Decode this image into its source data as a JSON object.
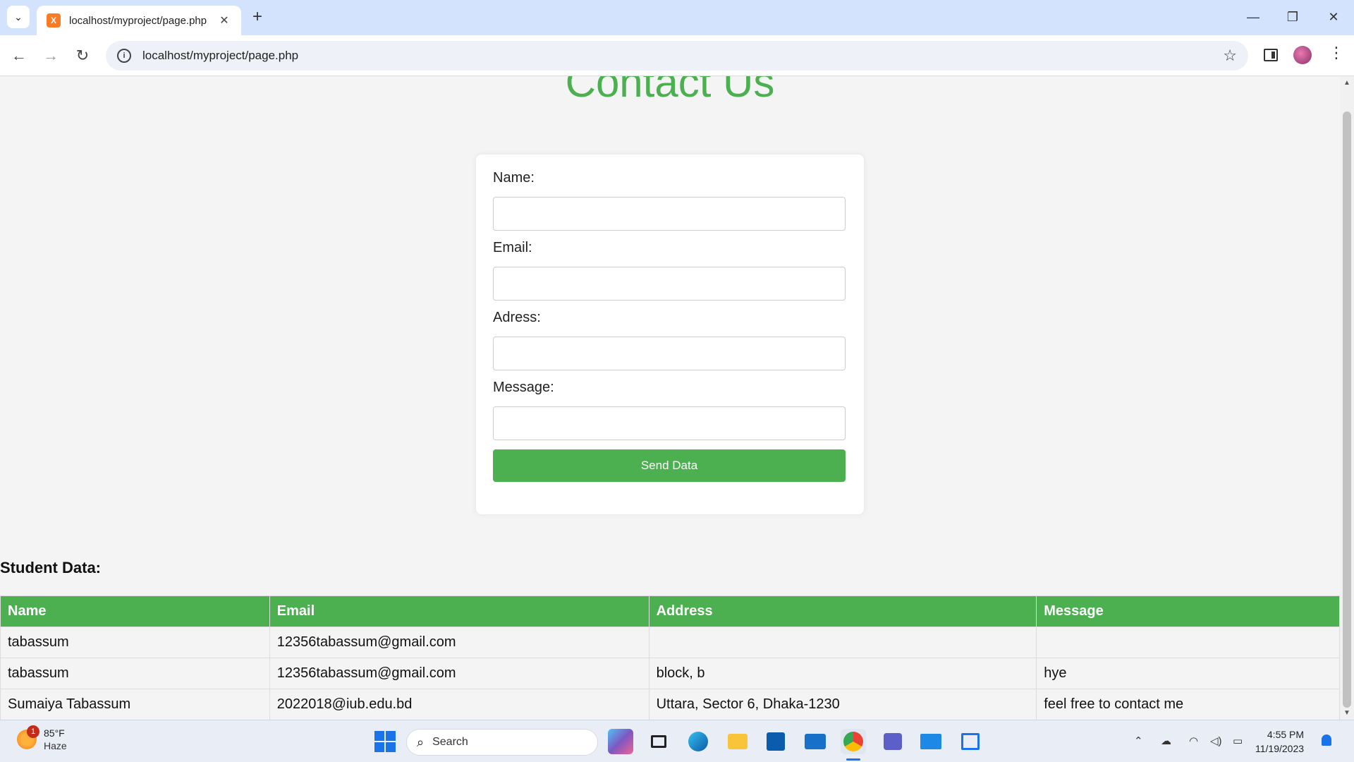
{
  "browser": {
    "tab_title": "localhost/myproject/page.php",
    "url": "localhost/myproject/page.php",
    "favicon_letter": "X"
  },
  "page": {
    "title": "Contact Us",
    "form": {
      "name_label": "Name:",
      "name_value": "",
      "email_label": "Email:",
      "email_value": "",
      "address_label": "Adress:",
      "address_value": "",
      "message_label": "Message:",
      "message_value": "",
      "submit_label": "Send Data"
    },
    "section_heading": "Student Data:",
    "table": {
      "headers": [
        "Name",
        "Email",
        "Address",
        "Message"
      ],
      "rows": [
        [
          "tabassum",
          "12356tabassum@gmail.com",
          "",
          ""
        ],
        [
          "tabassum",
          "12356tabassum@gmail.com",
          "block, b",
          "hye"
        ],
        [
          "Sumaiya Tabassum",
          "2022018@iub.edu.bd",
          "Uttara, Sector 6, Dhaka-1230",
          "feel free to contact me"
        ]
      ]
    }
  },
  "taskbar": {
    "weather_badge": "1",
    "temperature": "85°F",
    "condition": "Haze",
    "search_label": "Search",
    "time": "4:55 PM",
    "date": "11/19/2023"
  },
  "colors": {
    "accent": "#4caf50",
    "tab_bar": "#d3e3fd"
  }
}
